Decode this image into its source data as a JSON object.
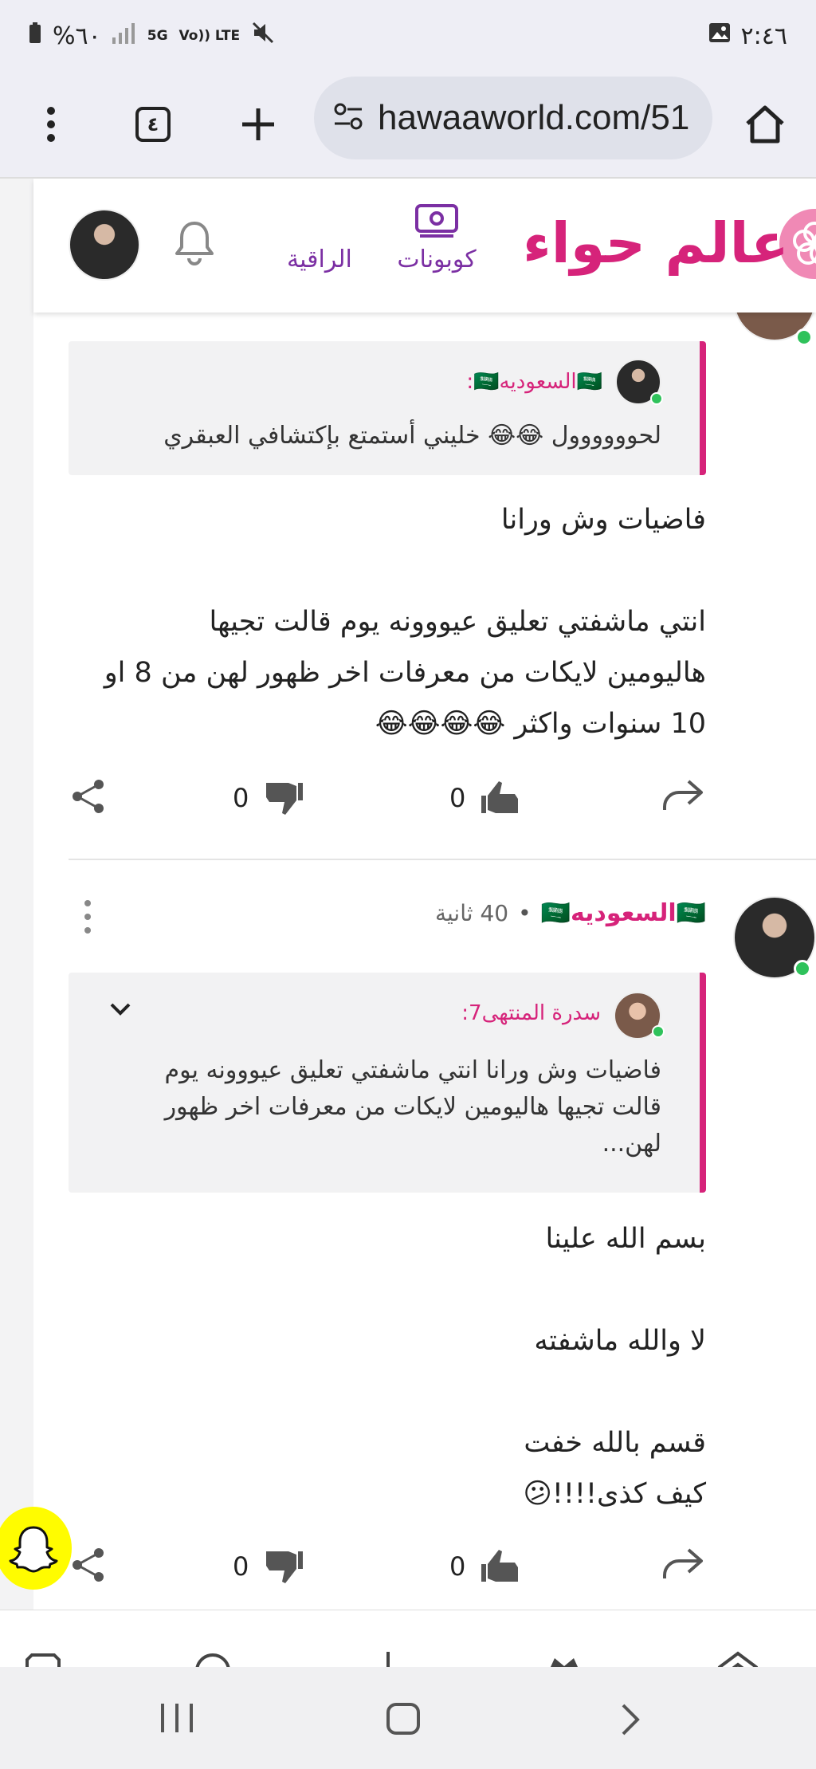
{
  "status_bar": {
    "time": "٢:٤٦",
    "battery": "%٦٠",
    "network": "5G",
    "volte": "Vo)) LTE"
  },
  "browser": {
    "url": "hawaaworld.com/51",
    "tab_count": "٤"
  },
  "site_header": {
    "logo": "عالم حواء",
    "coupons_label": "كوبونات",
    "raqia_label": "الراقية"
  },
  "post1": {
    "quote_author": "🇸🇦السعوديه🇸🇦:",
    "quote_text": "لحوووووول 😂😂 خليني أستمتع بإكتشافي العبقري",
    "body_line1": "فاضيات وش ورانا",
    "body_line2": "انتي ماشفتي تعليق عيووونه يوم قالت تجيها",
    "body_line3": "هاليومين لايكات من معرفات اخر ظهور لهن من 8 او",
    "body_line4": "10 سنوات واكثر 😂😂😂😂",
    "likes": "0",
    "dislikes": "0"
  },
  "post2": {
    "author": "🇸🇦السعوديه🇸🇦",
    "time": "40 ثانية",
    "quote_author": "سدرة المنتهى7:",
    "quote_line1": "فاضيات وش ورانا انتي ماشفتي تعليق عيووونه يوم",
    "quote_line2": "قالت تجيها هاليومين لايكات من معرفات اخر ظهور",
    "quote_line3": "لهن...",
    "body_line1": "بسم الله علينا",
    "body_line2": "لا والله ماشفته",
    "body_line3": "قسم بالله خفت",
    "body_line4": "كيف كذى!!!!😕",
    "likes": "0",
    "dislikes": "0"
  },
  "colors": {
    "brand": "#d6237a",
    "purple": "#7b2fa3",
    "online": "#2fc25b"
  }
}
